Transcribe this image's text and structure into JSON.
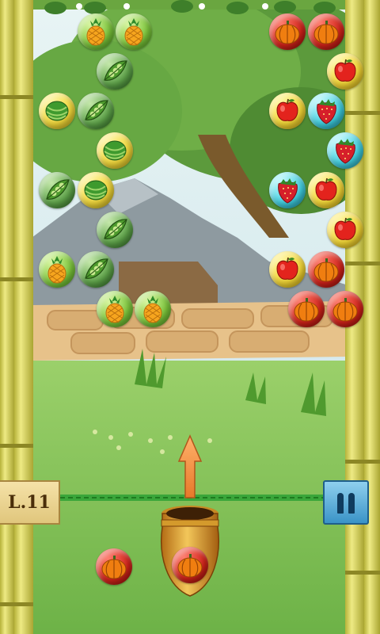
{
  "level": {
    "label": "L.11"
  },
  "bubbles": [
    {
      "fruit": "pineapple",
      "col": 1,
      "row": 0
    },
    {
      "fruit": "pineapple",
      "col": 2,
      "row": 0
    },
    {
      "fruit": "pumpkin",
      "col": 6,
      "row": 0
    },
    {
      "fruit": "pumpkin",
      "col": 7,
      "row": 0
    },
    {
      "fruit": "peas",
      "col": 1,
      "row": 1
    },
    {
      "fruit": "apple",
      "col": 7,
      "row": 1
    },
    {
      "fruit": "watermelon",
      "col": 0,
      "row": 2
    },
    {
      "fruit": "peas",
      "col": 1,
      "row": 2
    },
    {
      "fruit": "apple",
      "col": 6,
      "row": 2
    },
    {
      "fruit": "strawberry",
      "col": 7,
      "row": 2
    },
    {
      "fruit": "watermelon",
      "col": 1,
      "row": 3
    },
    {
      "fruit": "strawberry",
      "col": 7,
      "row": 3
    },
    {
      "fruit": "peas",
      "col": 0,
      "row": 4
    },
    {
      "fruit": "watermelon",
      "col": 1,
      "row": 4
    },
    {
      "fruit": "strawberry",
      "col": 6,
      "row": 4
    },
    {
      "fruit": "apple",
      "col": 7,
      "row": 4
    },
    {
      "fruit": "peas",
      "col": 1,
      "row": 5
    },
    {
      "fruit": "apple",
      "col": 7,
      "row": 5
    },
    {
      "fruit": "pineapple",
      "col": 0,
      "row": 6
    },
    {
      "fruit": "peas",
      "col": 1,
      "row": 6
    },
    {
      "fruit": "apple",
      "col": 6,
      "row": 6
    },
    {
      "fruit": "pumpkin",
      "col": 7,
      "row": 6
    },
    {
      "fruit": "pineapple",
      "col": 1,
      "row": 7
    },
    {
      "fruit": "pineapple",
      "col": 2,
      "row": 7
    },
    {
      "fruit": "pumpkin",
      "col": 6,
      "row": 7
    },
    {
      "fruit": "pumpkin",
      "col": 7,
      "row": 7
    }
  ],
  "cannon": {
    "loaded_fruit": "pumpkin"
  },
  "next_bubble": {
    "fruit": "pumpkin"
  },
  "icons": {
    "pause": "pause-icon",
    "aim": "aim-arrow-icon"
  },
  "colors": {
    "bamboo": "#d8d454",
    "sky": "#cfe7f2",
    "rope": "#3aa63a",
    "level_badge": "#f0d894",
    "pause_button": "#5fb0de"
  }
}
